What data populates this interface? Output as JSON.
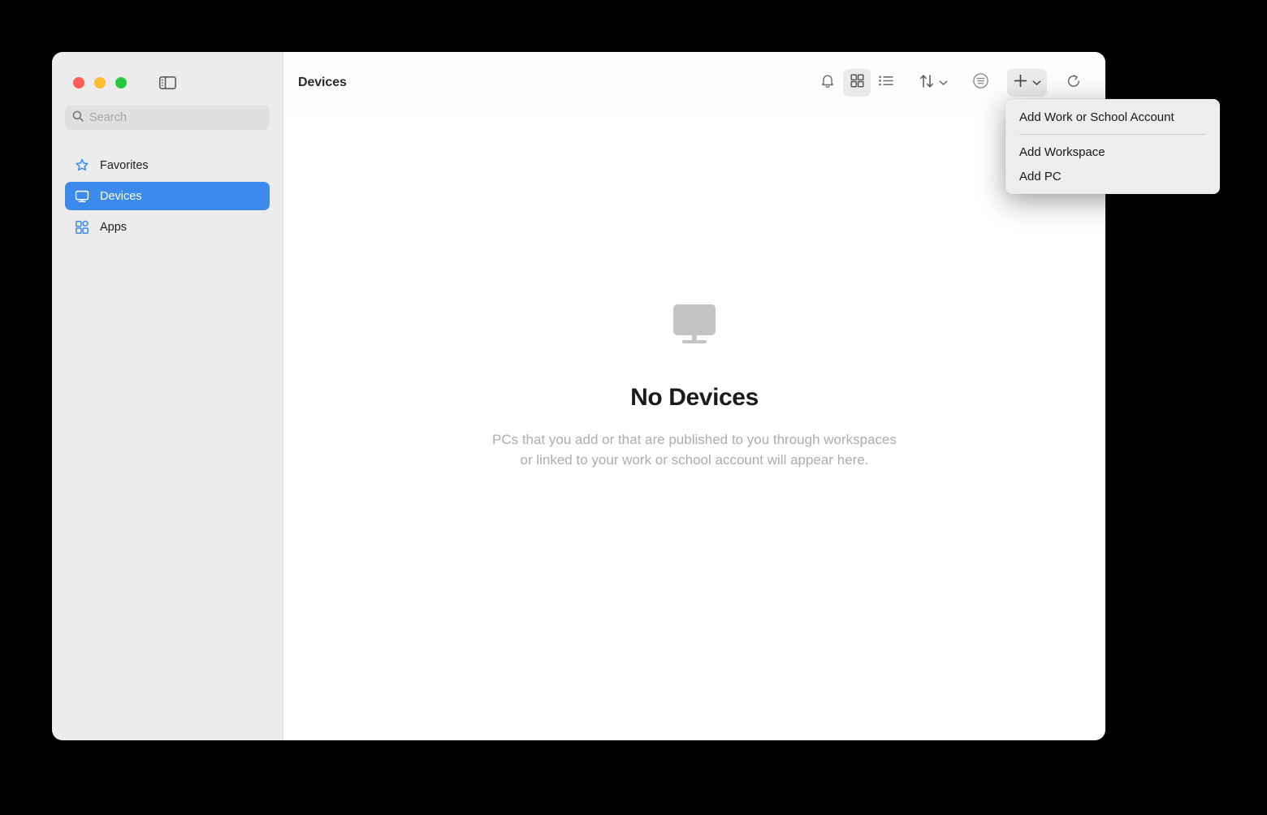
{
  "window": {
    "traffic_lights": [
      {
        "name": "close",
        "color": "#ff5f57"
      },
      {
        "name": "minimize",
        "color": "#febc2e"
      },
      {
        "name": "zoom",
        "color": "#28c840"
      }
    ],
    "sidebar_toggle_label": "Toggle Sidebar"
  },
  "sidebar": {
    "search": {
      "value": "",
      "placeholder": "Search",
      "icon": "search-icon"
    },
    "items": [
      {
        "label": "Favorites",
        "icon": "star-icon",
        "selected": false
      },
      {
        "label": "Devices",
        "icon": "monitor-icon",
        "selected": true
      },
      {
        "label": "Apps",
        "icon": "apps-grid-icon",
        "selected": false
      }
    ],
    "accent_color": "#3b8aec",
    "background_color": "#ececec"
  },
  "toolbar": {
    "title": "Devices",
    "buttons": [
      {
        "name": "notifications",
        "icon": "bell-icon",
        "active": false
      },
      {
        "name": "grid-view",
        "icon": "grid-view-icon",
        "active": true
      },
      {
        "name": "list-view",
        "icon": "list-view-icon",
        "active": false
      },
      {
        "name": "sort",
        "icon": "sort-arrows-icon",
        "active": false,
        "has_chevron": true
      },
      {
        "name": "filter",
        "icon": "filter-circle-icon",
        "active": false
      },
      {
        "name": "add",
        "icon": "plus-icon",
        "active": true,
        "has_chevron": true
      },
      {
        "name": "refresh",
        "icon": "refresh-icon",
        "active": false
      }
    ]
  },
  "empty_state": {
    "icon": "monitor-large-icon",
    "title": "No Devices",
    "description": "PCs that you add or that are published to you through workspaces or linked to your work or school account will appear here."
  },
  "add_menu": {
    "open": true,
    "items": [
      {
        "label": "Add Work or School Account",
        "separator_after": true
      },
      {
        "label": "Add Workspace",
        "separator_after": false
      },
      {
        "label": "Add PC",
        "separator_after": false
      }
    ]
  }
}
